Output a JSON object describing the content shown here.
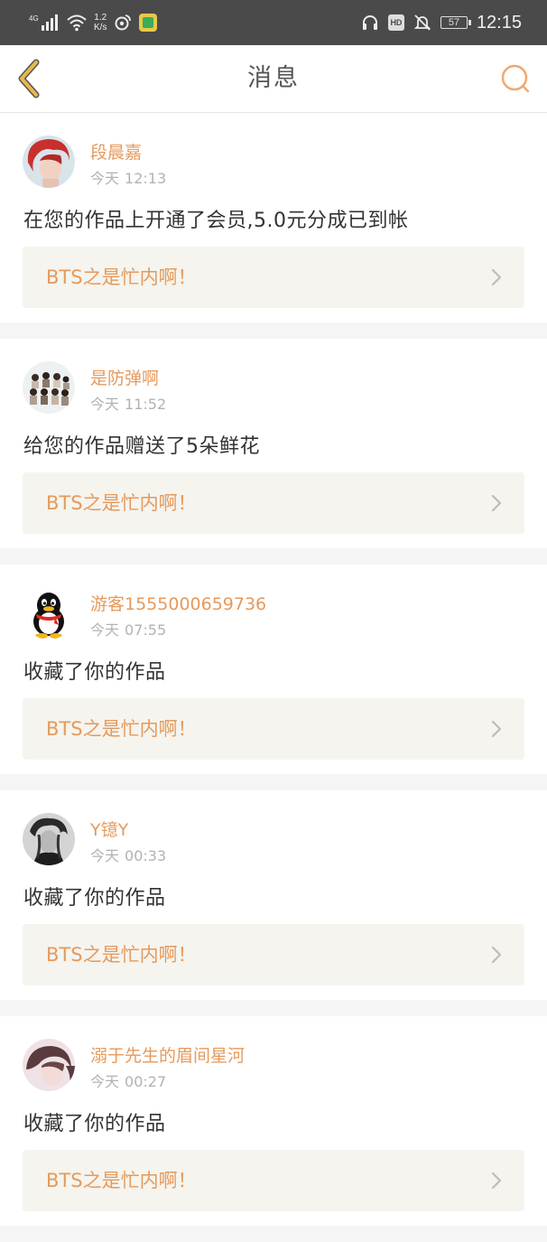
{
  "status_bar": {
    "signal_label": "4G",
    "net_speed_value": "1.2",
    "net_speed_unit": "K/s",
    "hd_badge": "HD",
    "battery": "57",
    "time": "12:15"
  },
  "header": {
    "title": "消息"
  },
  "colors": {
    "accent": "#e59a5c",
    "back_arrow": "#e0b040",
    "work_bg": "#f5f4ee"
  },
  "notifications": [
    {
      "username": "段晨嘉",
      "day": "今天",
      "time": "12:13",
      "message": "在您的作品上开通了会员,5.0元分成已到帐",
      "work_title": "BTS之是忙内啊！",
      "avatar": "red-hair-portrait"
    },
    {
      "username": "是防弹啊",
      "day": "今天",
      "time": "11:52",
      "message": "给您的作品赠送了5朵鲜花",
      "work_title": "BTS之是忙内啊！",
      "avatar": "group-photo"
    },
    {
      "username": "游客1555000659736",
      "day": "今天",
      "time": "07:55",
      "message": "收藏了你的作品",
      "work_title": "BTS之是忙内啊！",
      "avatar": "qq-penguin"
    },
    {
      "username": "Y镱Y",
      "day": "今天",
      "time": "00:33",
      "message": "收藏了你的作品",
      "work_title": "BTS之是忙内啊！",
      "avatar": "monochrome-portrait"
    },
    {
      "username": "溺于先生的眉间星河",
      "day": "今天",
      "time": "00:27",
      "message": "收藏了你的作品",
      "work_title": "BTS之是忙内啊！",
      "avatar": "pink-portrait"
    }
  ]
}
